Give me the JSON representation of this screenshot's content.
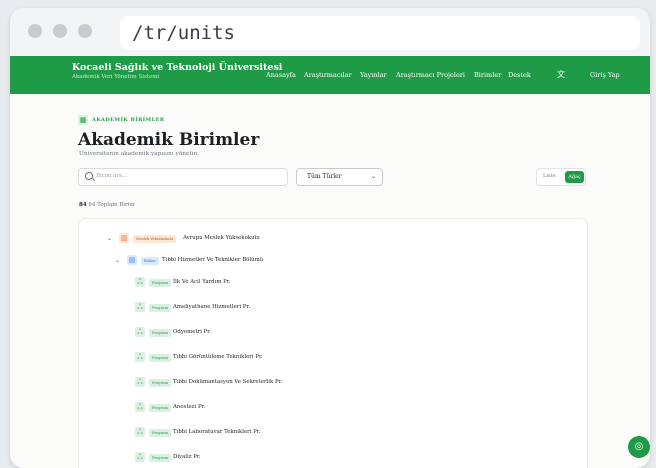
{
  "browser": {
    "url": "/tr/units"
  },
  "navbar": {
    "brand_title": "Kocaeli Sağlık ve Teknoloji Üniversitesi",
    "brand_subtitle": "Akademik Veri Yönetim Sistemi",
    "links": [
      "Anasayfa",
      "Araştırmacılar",
      "Yayınlar",
      "Araştırmacı Projeleri",
      "Birimler",
      "Destek"
    ],
    "login_label": "Giriş Yap"
  },
  "page": {
    "breadcrumb": "AKADEMİK BİRİMLER",
    "title": "Akademik Birimler",
    "subtitle": "Üniversitenin akademik yapısını yönetin."
  },
  "filters": {
    "search_placeholder": "Birim ara...",
    "type_select_value": "Tüm Türler",
    "view_list_label": "Liste",
    "view_tree_label": "Ağaç"
  },
  "summary": {
    "count": "84",
    "count_text": "84 Toplam Birim"
  },
  "tree": {
    "root": {
      "badge": "Meslek Yüksekokulu",
      "label": "Avrupa Meslek Yüksekokulu"
    },
    "dept": {
      "badge": "Bölüm",
      "label": "Tıbbi Hizmetler Ve Teknikler Bölümü"
    },
    "programs": [
      {
        "badge": "Program",
        "label": "İlk Ve Acil Yardım Pr."
      },
      {
        "badge": "Program",
        "label": "Ameliyathane Hizmetleri Pr."
      },
      {
        "badge": "Program",
        "label": "Odyometri Pr."
      },
      {
        "badge": "Program",
        "label": "Tıbbi Görüntüleme Teknikleri Pr."
      },
      {
        "badge": "Program",
        "label": "Tıbbi Dokümantasyon Ve Sekreterlik Pr."
      },
      {
        "badge": "Program",
        "label": "Anestezi Pr."
      },
      {
        "badge": "Program",
        "label": "Tıbbi Laboratuvar Teknikleri Pr."
      },
      {
        "badge": "Program",
        "label": "Diyaliz Pr."
      }
    ]
  },
  "colors": {
    "brand": "#1f9a47",
    "badge_myo": "#f59e5b",
    "badge_dept": "#3b82f6",
    "badge_prog": "#1f9a47"
  }
}
